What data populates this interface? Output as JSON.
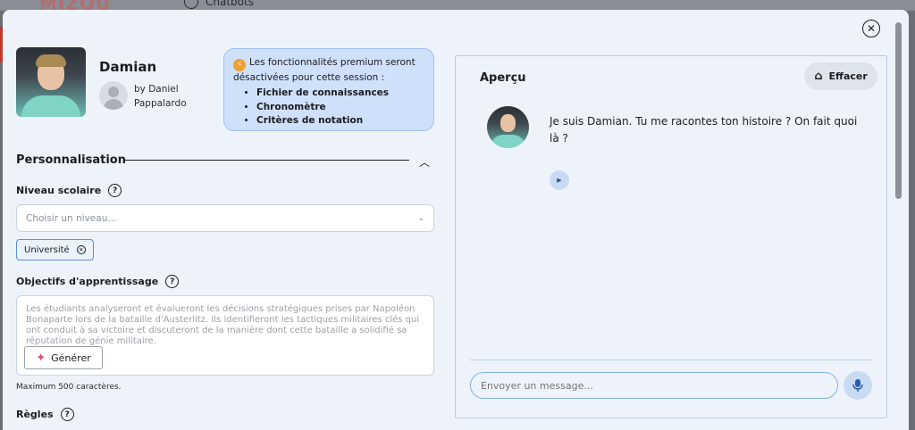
{
  "background": {
    "logo": "MIZOU",
    "nav_item": "Chatbots"
  },
  "profile": {
    "name": "Damian",
    "by_label": "by Daniel Pappalardo"
  },
  "premium_notice": {
    "text": "Les fonctionnalités premium seront désactivées pour cette session :",
    "items": [
      "Fichier de connaissances",
      "Chronomètre",
      "Critères de notation"
    ]
  },
  "section": {
    "title": "Personnalisation"
  },
  "niveau": {
    "label": "Niveau scolaire",
    "placeholder": "Choisir un niveau...",
    "selected_chip": "Université"
  },
  "objectifs": {
    "label": "Objectifs d'apprentissage",
    "placeholder": "Les étudiants analyseront et évalueront les décisions stratégiques prises par Napoléon Bonaparte lors de la bataille d'Austerlitz. Ils identifieront les tactiques militaires clés qui ont conduit à sa victoire et discuteront de la manière dont cette bataille a solidifié sa réputation de génie militaire.",
    "generate_label": "Générer",
    "max_chars": "Maximum 500 caractères."
  },
  "regles": {
    "label": "Règles"
  },
  "preview": {
    "title": "Aperçu",
    "clear_label": "Effacer",
    "bot_message": "Je suis Damian. Tu me racontes ton histoire ? On fait quoi là ?",
    "input_placeholder": "Envoyer un message..."
  },
  "colors": {
    "accent": "#5d8fd6",
    "modal_bg": "#eef3fb",
    "premium_bg": "#cfe0fa"
  }
}
